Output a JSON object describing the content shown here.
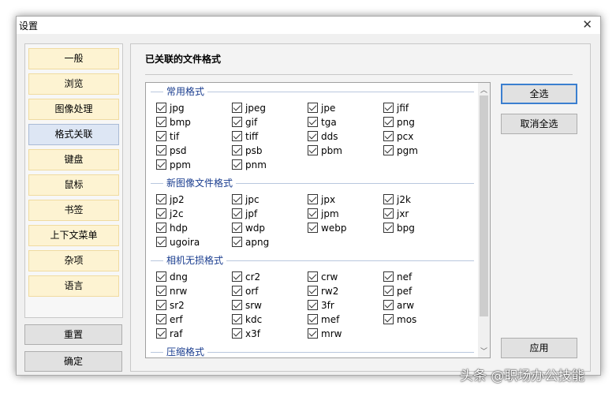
{
  "window": {
    "title": "设置",
    "close_icon": "close-icon"
  },
  "sidebar": {
    "items": [
      {
        "label": "一般"
      },
      {
        "label": "浏览"
      },
      {
        "label": "图像处理"
      },
      {
        "label": "格式关联",
        "active": true
      },
      {
        "label": "键盘"
      },
      {
        "label": "鼠标"
      },
      {
        "label": "书签"
      },
      {
        "label": "上下文菜单"
      },
      {
        "label": "杂项"
      },
      {
        "label": "语言"
      }
    ],
    "reset": "重置",
    "ok": "确定"
  },
  "main": {
    "title": "已关联的文件格式",
    "select_all": "全选",
    "deselect_all": "取消全选",
    "apply": "应用",
    "groups": [
      {
        "name": "常用格式",
        "items": [
          "jpg",
          "jpeg",
          "jpe",
          "jfif",
          "bmp",
          "gif",
          "tga",
          "png",
          "tif",
          "tiff",
          "dds",
          "pcx",
          "psd",
          "psb",
          "pbm",
          "pgm",
          "ppm",
          "pnm"
        ]
      },
      {
        "name": "新图像文件格式",
        "items": [
          "jp2",
          "jpc",
          "jpx",
          "j2k",
          "j2c",
          "jpf",
          "jpm",
          "jxr",
          "hdp",
          "wdp",
          "webp",
          "bpg",
          "ugoira",
          "apng"
        ]
      },
      {
        "name": "相机无损格式",
        "items": [
          "dng",
          "cr2",
          "crw",
          "nef",
          "nrw",
          "orf",
          "rw2",
          "pef",
          "sr2",
          "srw",
          "3fr",
          "arw",
          "erf",
          "kdc",
          "mef",
          "mos",
          "raf",
          "x3f",
          "mrw"
        ]
      },
      {
        "name": "压缩格式",
        "items": []
      }
    ]
  },
  "watermark": "头条 @职场办公技能"
}
